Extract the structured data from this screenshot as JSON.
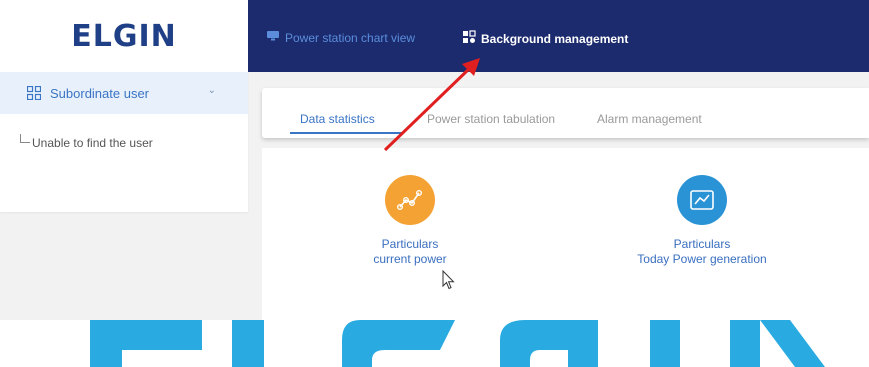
{
  "brand": {
    "logo": "ELGIN"
  },
  "topnav": {
    "items": [
      {
        "label": "Power station chart view",
        "icon": "monitor-icon",
        "color": "#5b8ddc"
      },
      {
        "label": "Background management",
        "icon": "grid-gear-icon",
        "color": "#ffffff"
      }
    ]
  },
  "sidebar": {
    "header": {
      "label": "Subordinate user",
      "icon": "grid-icon",
      "chevron": "chevron-down-icon"
    },
    "tree_item": "Unable to find the user"
  },
  "tabs": [
    {
      "label": "Data statistics",
      "active": true
    },
    {
      "label": "Power station tabulation",
      "active": false
    },
    {
      "label": "Alarm management",
      "active": false
    }
  ],
  "stats": [
    {
      "line1": "Particulars",
      "line2": "current power",
      "icon": "trend-dots-icon",
      "color": "#f4a233"
    },
    {
      "line1": "Particulars",
      "line2": "Today Power generation",
      "icon": "line-chart-icon",
      "color": "#2a93d5"
    }
  ],
  "watermark": {
    "text": "ELGIN",
    "color": "#29abe2"
  },
  "annotation": {
    "arrow_color": "#e02020"
  }
}
